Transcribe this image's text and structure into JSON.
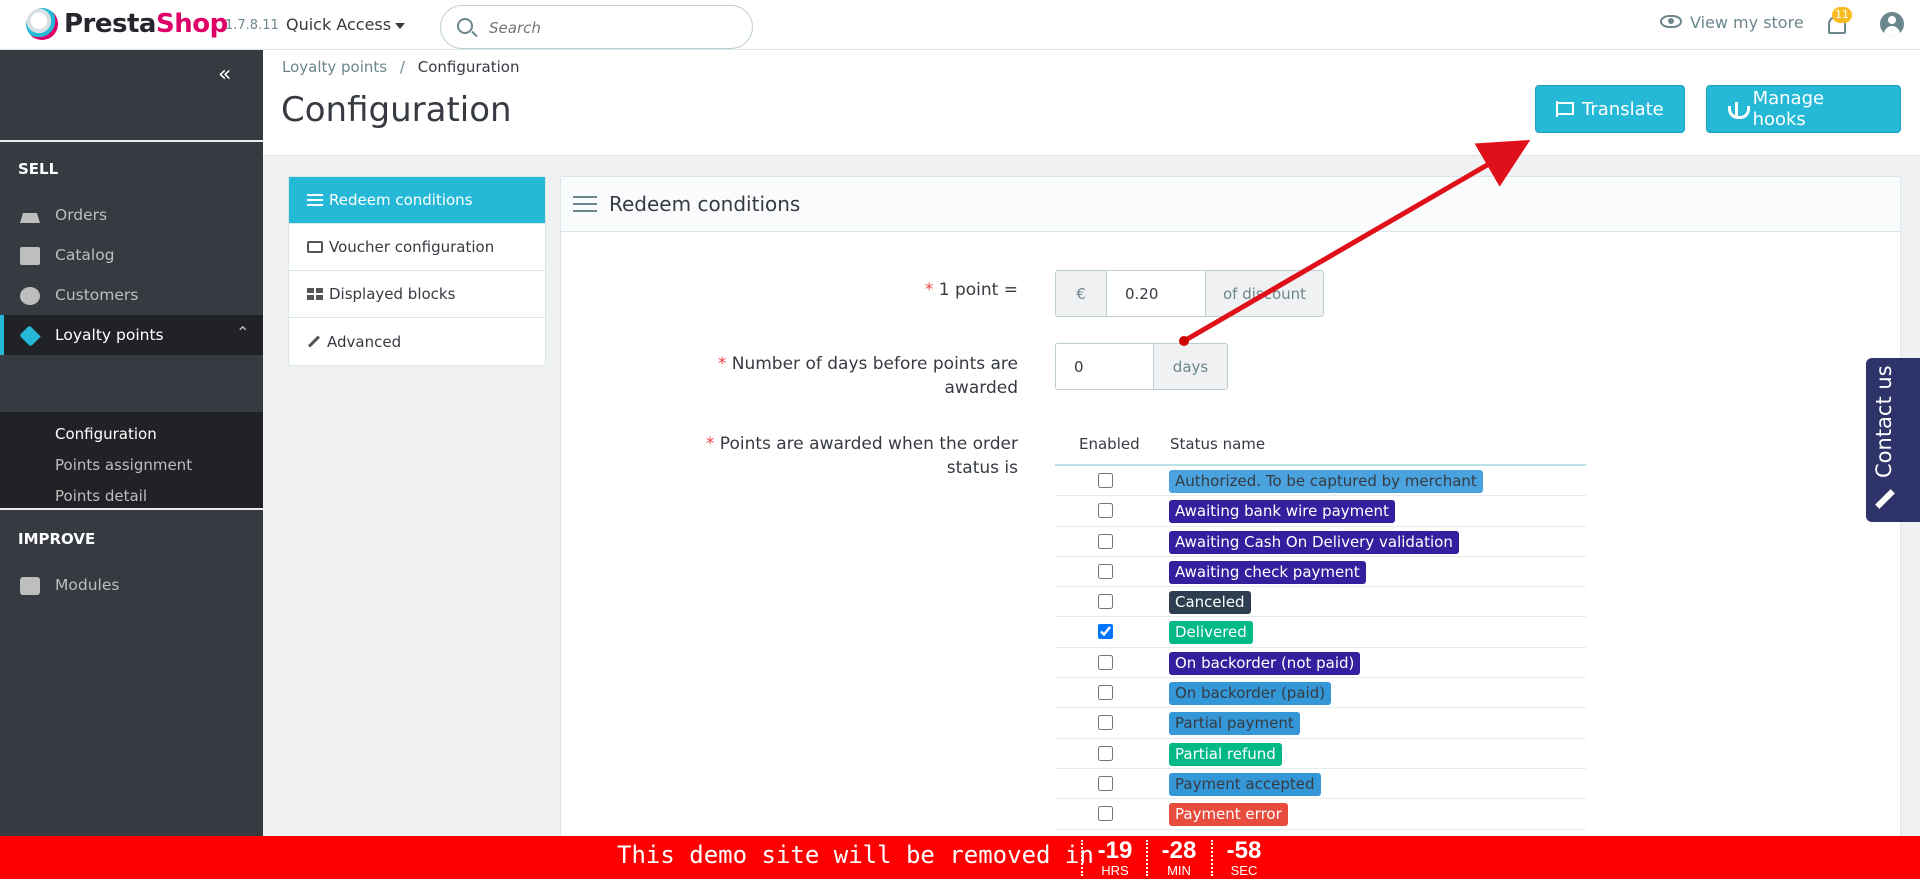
{
  "header": {
    "logo_text_a": "Presta",
    "logo_text_b": "Shop",
    "version": "1.7.8.11",
    "quick_access": "Quick Access",
    "search_placeholder": "Search",
    "view_store": "View my store",
    "notification_count": "11"
  },
  "sidebar": {
    "sections": [
      {
        "title": "SELL"
      },
      {
        "title": "IMPROVE"
      }
    ],
    "items": [
      {
        "label": "Orders",
        "icon": "basket-icon"
      },
      {
        "label": "Catalog",
        "icon": "store-icon"
      },
      {
        "label": "Customers",
        "icon": "customer-icon"
      },
      {
        "label": "Loyalty points",
        "icon": "tag-icon"
      },
      {
        "label": "Modules",
        "icon": "puzzle-icon"
      }
    ],
    "sub_items": [
      {
        "label": "Configuration"
      },
      {
        "label": "Points assignment"
      },
      {
        "label": "Points detail"
      }
    ]
  },
  "breadcrumb": {
    "parent": "Loyalty points",
    "separator": "/",
    "current": "Configuration"
  },
  "page_title": "Configuration",
  "toolbar": {
    "translate": "Translate",
    "manage_hooks": "Manage hooks"
  },
  "tabs": [
    {
      "label": "Redeem conditions",
      "icon": "list-icon"
    },
    {
      "label": "Voucher configuration",
      "icon": "money-icon"
    },
    {
      "label": "Displayed blocks",
      "icon": "grid-icon"
    },
    {
      "label": "Advanced",
      "icon": "wand-icon"
    }
  ],
  "panel": {
    "title": "Redeem conditions",
    "point_label": "1 point =",
    "point_prefix": "€",
    "point_value": "0.20",
    "point_suffix": "of discount",
    "days_label_line1": "Number of days before points are",
    "days_label_line2": "awarded",
    "days_value": "0",
    "days_suffix": "days",
    "status_label_line1": "Points are awarded when the order",
    "status_label_line2": "status is",
    "col_enabled": "Enabled",
    "col_status": "Status name",
    "required_mark": "*"
  },
  "statuses": [
    {
      "name": "Authorized. To be captured by merchant",
      "color": "#4aa3df",
      "text": "#363a41",
      "checked": false
    },
    {
      "name": "Awaiting bank wire payment",
      "color": "#34209e",
      "text": "#ffffff",
      "checked": false
    },
    {
      "name": "Awaiting Cash On Delivery validation",
      "color": "#34209e",
      "text": "#ffffff",
      "checked": false
    },
    {
      "name": "Awaiting check payment",
      "color": "#34209e",
      "text": "#ffffff",
      "checked": false
    },
    {
      "name": "Canceled",
      "color": "#2c3e50",
      "text": "#ffffff",
      "checked": false
    },
    {
      "name": "Delivered",
      "color": "#01b887",
      "text": "#ffffff",
      "checked": true
    },
    {
      "name": "On backorder (not paid)",
      "color": "#34209e",
      "text": "#ffffff",
      "checked": false
    },
    {
      "name": "On backorder (paid)",
      "color": "#3498d8",
      "text": "#363a41",
      "checked": false
    },
    {
      "name": "Partial payment",
      "color": "#3498d8",
      "text": "#363a41",
      "checked": false
    },
    {
      "name": "Partial refund",
      "color": "#01b887",
      "text": "#ffffff",
      "checked": false
    },
    {
      "name": "Payment accepted",
      "color": "#3498d8",
      "text": "#363a41",
      "checked": false
    },
    {
      "name": "Payment error",
      "color": "#e74c3c",
      "text": "#ffffff",
      "checked": false
    }
  ],
  "contact": {
    "label": "Contact us"
  },
  "demo_bar": {
    "message": "This demo site will be removed in",
    "hours": "-19",
    "hours_unit": "HRS",
    "minutes": "-28",
    "minutes_unit": "MIN",
    "seconds": "-58",
    "seconds_unit": "SEC"
  },
  "colors": {
    "accent": "#25b9d7",
    "sidebar": "#363a41",
    "demo_bar": "#ff0000",
    "brand": "#df0067"
  }
}
